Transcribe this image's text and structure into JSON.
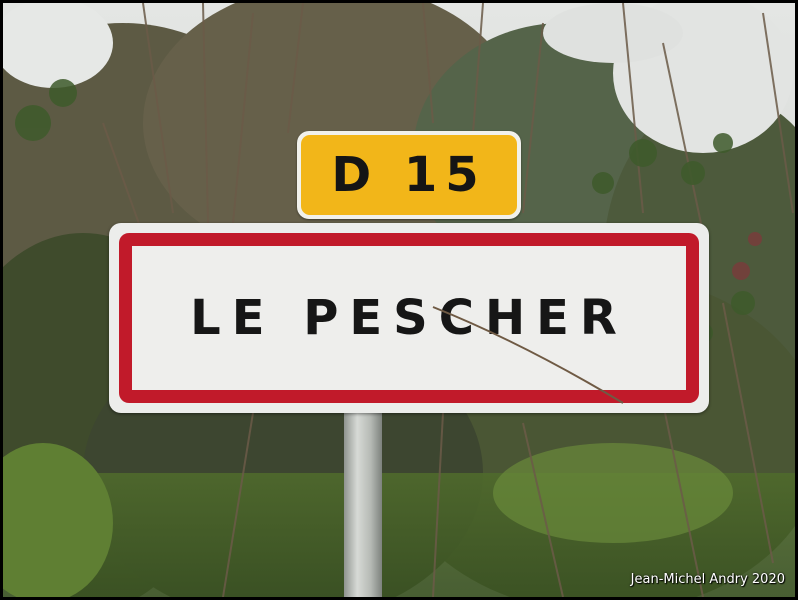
{
  "route_sign": {
    "text": "D 15",
    "color": "#f2b619"
  },
  "town_sign": {
    "name": "LE PESCHER",
    "border_color": "#c11a2a"
  },
  "credit": "Jean-Michel Andry 2020"
}
